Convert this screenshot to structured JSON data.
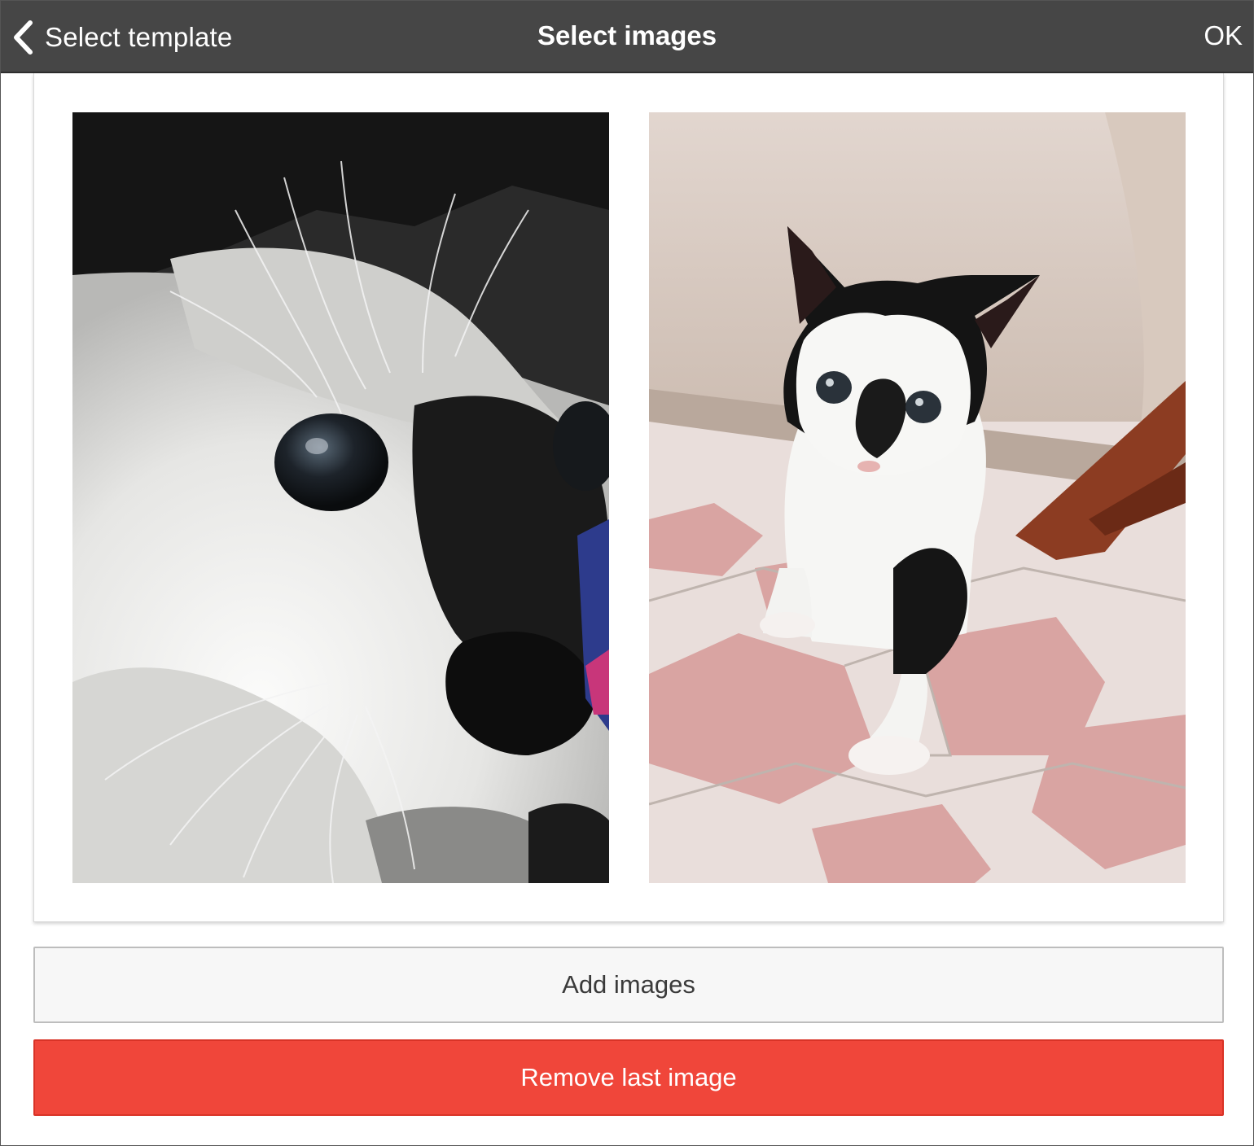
{
  "navbar": {
    "back_label": "Select template",
    "title": "Select images",
    "ok_label": "OK"
  },
  "preview": {
    "images": [
      {
        "subject": "close-up of a black and white kitten face"
      },
      {
        "subject": "black and white kitten walking on pink and beige tiled floor"
      }
    ]
  },
  "actions": {
    "add_label": "Add images",
    "remove_label": "Remove last image"
  },
  "colors": {
    "navbar_bg": "#464646",
    "remove_button_bg": "#f0463a",
    "add_button_bg": "#f7f7f7"
  }
}
